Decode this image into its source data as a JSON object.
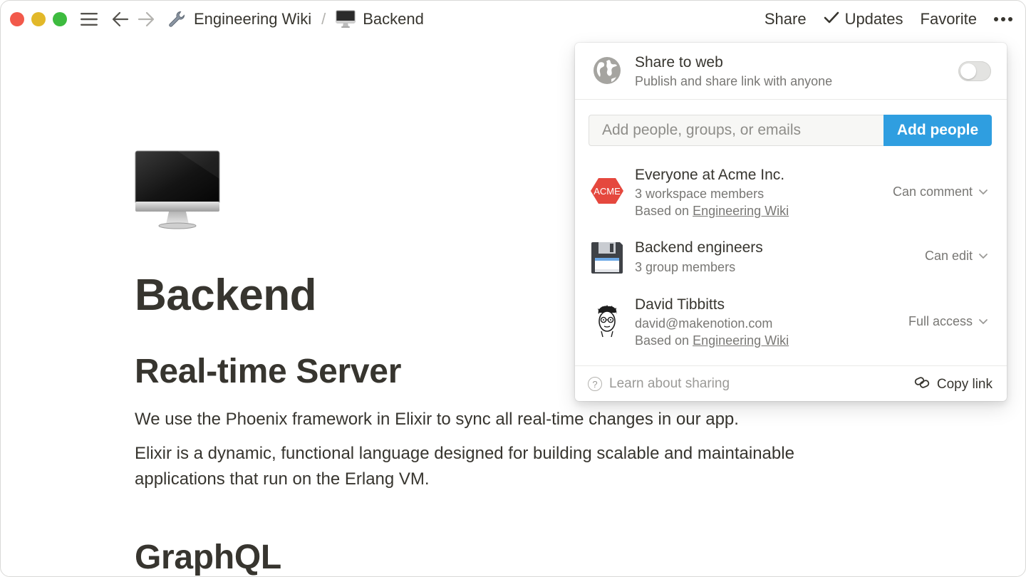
{
  "topbar": {
    "breadcrumbs": [
      {
        "label": "Engineering Wiki",
        "icon": "wrench-icon"
      },
      {
        "label": "Backend",
        "icon": "desktop-computer-icon"
      }
    ],
    "separator": "/",
    "actions": {
      "share": "Share",
      "updates": "Updates",
      "favorite": "Favorite"
    }
  },
  "page": {
    "icon": "desktop-computer-icon",
    "title": "Backend",
    "sections": [
      {
        "heading": "Real-time Server",
        "paragraphs": [
          "We use the Phoenix framework in Elixir to sync all real-time changes in our app.",
          "Elixir is a dynamic, functional language designed for building scalable and maintainable applications that run on the Erlang VM."
        ]
      },
      {
        "heading": "GraphQL"
      }
    ]
  },
  "share_popup": {
    "web": {
      "title": "Share to web",
      "subtitle": "Publish and share link with anyone",
      "enabled": false
    },
    "invite": {
      "placeholder": "Add people, groups, or emails",
      "button": "Add people"
    },
    "members": [
      {
        "name": "Everyone at Acme Inc.",
        "line1": "3 workspace members",
        "based_prefix": "Based on ",
        "based_link": "Engineering Wiki",
        "permission": "Can comment",
        "avatar": "acme-logo-icon",
        "avatar_text": "ACME"
      },
      {
        "name": "Backend engineers",
        "line1": "3 group members",
        "permission": "Can edit",
        "avatar": "floppy-disk-icon"
      },
      {
        "name": "David Tibbitts",
        "line1": "david@makenotion.com",
        "based_prefix": "Based on ",
        "based_link": "Engineering Wiki",
        "permission": "Full access",
        "avatar": "user-avatar-icon"
      }
    ],
    "footer": {
      "learn": "Learn about sharing",
      "copy": "Copy link"
    }
  },
  "colors": {
    "accent": "#2f9ee0",
    "text": "#37352f",
    "muted": "#787774",
    "acme_red": "#e5483e"
  }
}
